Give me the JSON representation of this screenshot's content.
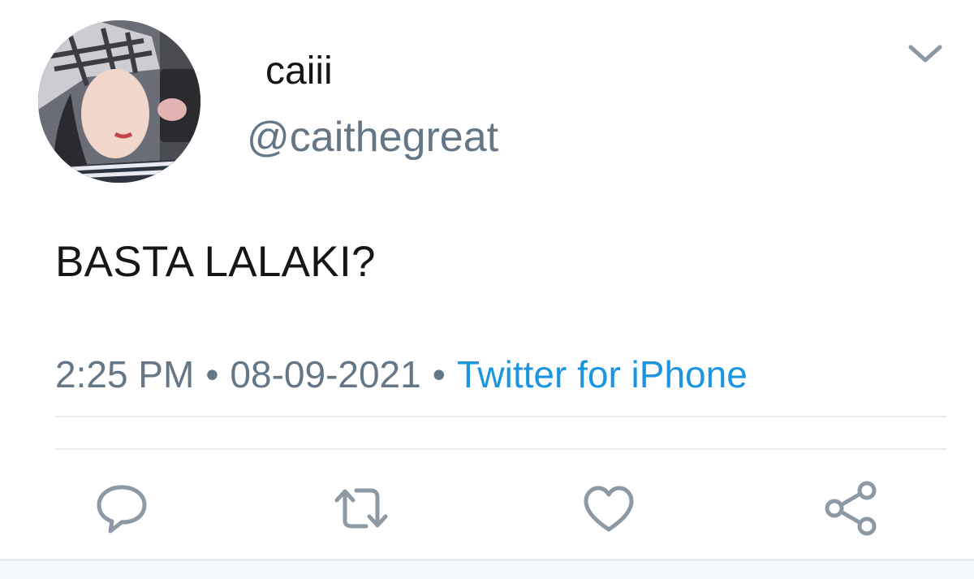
{
  "tweet": {
    "display_name": "caiii",
    "handle": "@caithegreat",
    "text": "BASTA LALAKI?",
    "time": "2:25 PM",
    "date": "08-09-2021",
    "separator": "•",
    "source": "Twitter for iPhone"
  },
  "icons": {
    "more": "chevron-down-icon",
    "reply": "reply-icon",
    "retweet": "retweet-icon",
    "like": "heart-icon",
    "share": "share-icon"
  },
  "colors": {
    "primary_text": "#14171a",
    "secondary_text": "#657786",
    "link": "#1b95e0",
    "icon": "#8d99a5",
    "divider": "#e6ecf0"
  }
}
